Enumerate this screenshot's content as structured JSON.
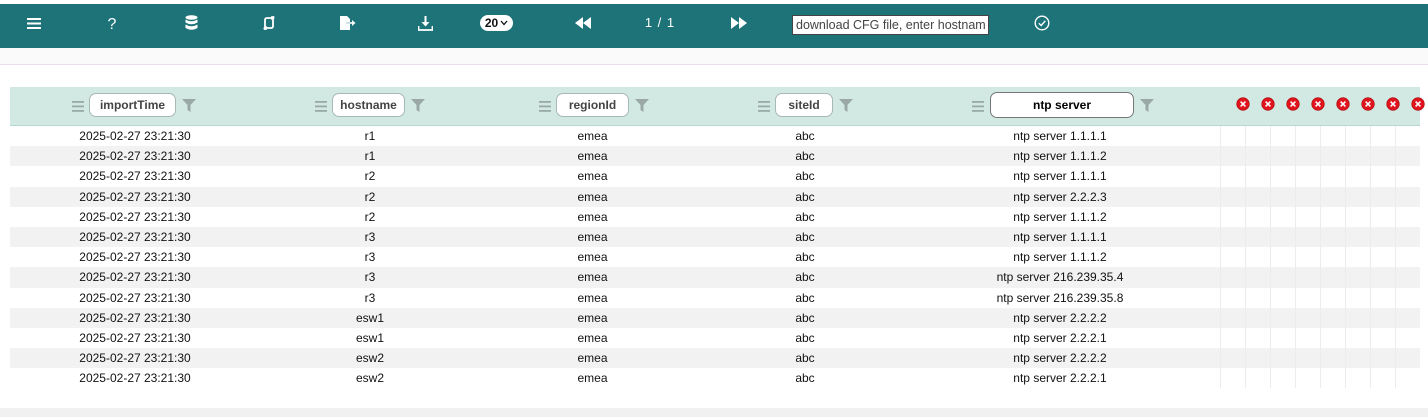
{
  "toolbar": {
    "icons": [
      "menu-icon",
      "help-icon",
      "database-icon",
      "sync-icon",
      "export-icon",
      "download-icon"
    ],
    "page_size": "20",
    "page_info": "1 / 1",
    "search_placeholder": "download CFG file, enter hostname",
    "colors": {
      "bar": "#1e7379",
      "header": "#d2e9e3",
      "clear": "#e0141e"
    }
  },
  "table": {
    "columns": [
      {
        "label": "importTime",
        "active": false
      },
      {
        "label": "hostname",
        "active": false
      },
      {
        "label": "regionId",
        "active": false
      },
      {
        "label": "siteId",
        "active": false
      },
      {
        "label": "ntp server",
        "active": true
      }
    ],
    "clear_buttons": 8,
    "rows": [
      {
        "importTime": "2025-02-27 23:21:30",
        "hostname": "r1",
        "regionId": "emea",
        "siteId": "abc",
        "ntp": "ntp server 1.1.1.1"
      },
      {
        "importTime": "2025-02-27 23:21:30",
        "hostname": "r1",
        "regionId": "emea",
        "siteId": "abc",
        "ntp": "ntp server 1.1.1.2"
      },
      {
        "importTime": "2025-02-27 23:21:30",
        "hostname": "r2",
        "regionId": "emea",
        "siteId": "abc",
        "ntp": "ntp server 1.1.1.1"
      },
      {
        "importTime": "2025-02-27 23:21:30",
        "hostname": "r2",
        "regionId": "emea",
        "siteId": "abc",
        "ntp": "ntp server 2.2.2.3"
      },
      {
        "importTime": "2025-02-27 23:21:30",
        "hostname": "r2",
        "regionId": "emea",
        "siteId": "abc",
        "ntp": "ntp server 1.1.1.2"
      },
      {
        "importTime": "2025-02-27 23:21:30",
        "hostname": "r3",
        "regionId": "emea",
        "siteId": "abc",
        "ntp": "ntp server 1.1.1.1"
      },
      {
        "importTime": "2025-02-27 23:21:30",
        "hostname": "r3",
        "regionId": "emea",
        "siteId": "abc",
        "ntp": "ntp server 1.1.1.2"
      },
      {
        "importTime": "2025-02-27 23:21:30",
        "hostname": "r3",
        "regionId": "emea",
        "siteId": "abc",
        "ntp": "ntp server 216.239.35.4"
      },
      {
        "importTime": "2025-02-27 23:21:30",
        "hostname": "r3",
        "regionId": "emea",
        "siteId": "abc",
        "ntp": "ntp server 216.239.35.8"
      },
      {
        "importTime": "2025-02-27 23:21:30",
        "hostname": "esw1",
        "regionId": "emea",
        "siteId": "abc",
        "ntp": "ntp server 2.2.2.2"
      },
      {
        "importTime": "2025-02-27 23:21:30",
        "hostname": "esw1",
        "regionId": "emea",
        "siteId": "abc",
        "ntp": "ntp server 2.2.2.1"
      },
      {
        "importTime": "2025-02-27 23:21:30",
        "hostname": "esw2",
        "regionId": "emea",
        "siteId": "abc",
        "ntp": "ntp server 2.2.2.2"
      },
      {
        "importTime": "2025-02-27 23:21:30",
        "hostname": "esw2",
        "regionId": "emea",
        "siteId": "abc",
        "ntp": "ntp server 2.2.2.1"
      }
    ]
  }
}
